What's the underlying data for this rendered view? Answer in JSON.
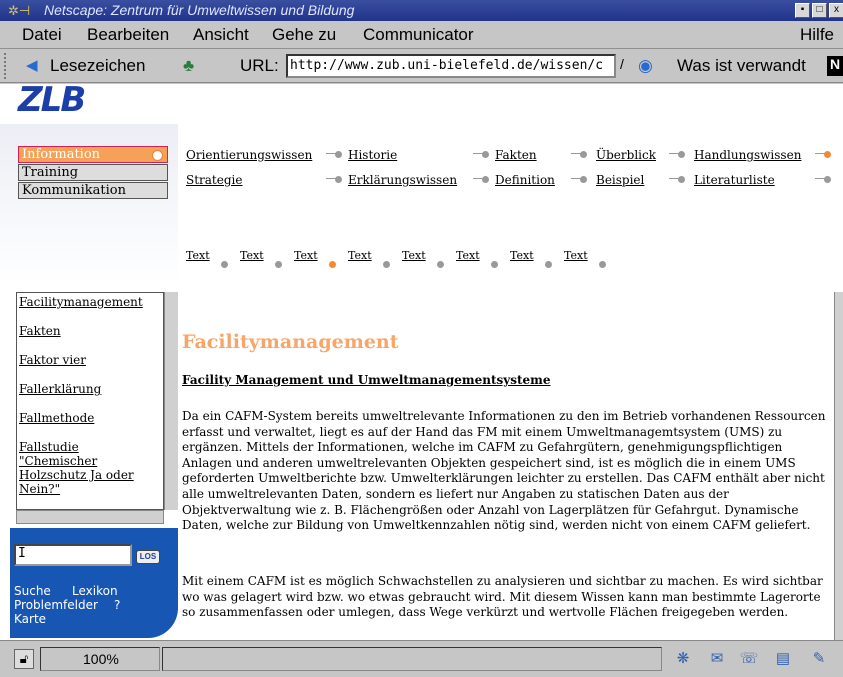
{
  "window": {
    "title": "Netscape: Zentrum für Umweltwissen und Bildung",
    "buttons": [
      "▪",
      "□",
      "x"
    ]
  },
  "menu": [
    "Datei",
    "Bearbeiten",
    "Ansicht",
    "Gehe zu",
    "Communicator",
    "Hilfe"
  ],
  "locbar": {
    "bookmarks_label": "Lesezeichen",
    "url_label": "URL:",
    "url_value": "http://www.zub.uni-bielefeld.de/wissen/c",
    "related_label": "Was ist verwandt"
  },
  "left": {
    "logo": "ZLB",
    "tabs": [
      "Information",
      "Training",
      "Kommunikation"
    ],
    "index_items": [
      "Facilitymanagement",
      "Fakten",
      "Faktor vier",
      "Fallerklärung",
      "Fallmethode",
      "Fallstudie \"Chemischer Holzschutz Ja oder Nein?\""
    ],
    "search_value": "I",
    "search_button": "LOS",
    "links": {
      "suche": "Suche",
      "lexikon": "Lexikon",
      "problemfelder": "Problemfelder",
      "help": "?",
      "karte": "Karte"
    }
  },
  "nav": {
    "row1": [
      "Orientierungswissen",
      "Historie",
      "Fakten",
      "Überblick",
      "Handlungswissen"
    ],
    "row2": [
      "Strategie",
      "Erklärungswissen",
      "Definition",
      "Beispiel",
      "Literaturliste"
    ],
    "text_links": [
      "Text",
      "Text",
      "Text",
      "Text",
      "Text",
      "Text",
      "Text",
      "Text"
    ],
    "active_text_index": 3
  },
  "article": {
    "heading": "Facilitymanagement",
    "subheading": "Facility Management und Umweltmanagementsysteme",
    "paragraphs": [
      "Da ein CAFM-System bereits umweltrelevante Informationen zu den im Betrieb vorhandenen Ressourcen erfasst und verwaltet, liegt es auf der Hand das FM mit einem Umweltmanagemtsystem (UMS) zu ergänzen. Mittels der Informationen, welche im CAFM zu Gefahrgütern, genehmigungspflichtigen Anlagen und anderen umweltrelevanten Objekten gespeichert sind, ist es möglich die in einem UMS geforderten Umweltberichte bzw. Umwelterklärungen leichter zu erstellen. Das CAFM enthält aber nicht alle umweltrelevanten Daten, sondern es liefert nur Angaben zu statischen Daten aus der Objektverwaltung wie z. B. Flächengrößen oder Anzahl von Lagerplätzen für Gefahrgut. Dynamische Daten, welche zur Bildung von Umweltkennzahlen nötig sind, werden nicht von einem CAFM geliefert.",
      "Mit einem CAFM ist es möglich Schwachstellen zu analysieren und sichtbar zu machen. Es wird sichtbar wo was gelagert wird bzw. wo etwas gebraucht wird. Mit diesem Wissen kann man bestimmte Lagerorte so zusammenfassen oder umlegen, dass Wege verkürzt und wertvolle Flächen freigegeben werden."
    ]
  },
  "status": {
    "zoom": "100%"
  },
  "colors": {
    "accent": "#f28a30",
    "title_bar": "#21338a",
    "search_panel": "#1856b4",
    "heading": "#f7a568"
  }
}
